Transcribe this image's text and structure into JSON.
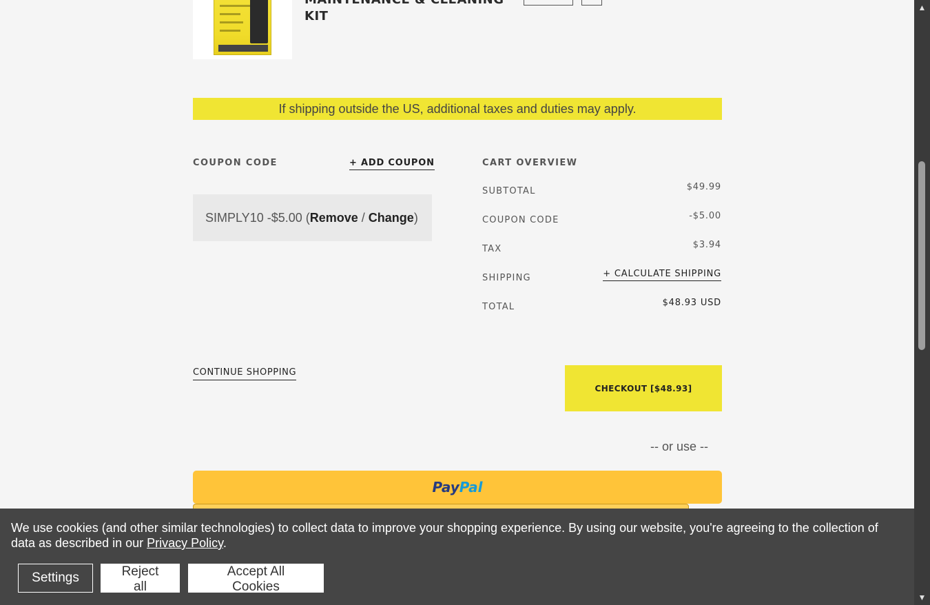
{
  "product": {
    "title": "MAINTENANCE & CLEANING KIT",
    "image_alt": "product-image"
  },
  "notice": "If shipping outside the US, additional taxes and duties may apply.",
  "coupon": {
    "label": "COUPON CODE",
    "add_label": "+ ADD COUPON",
    "applied_code": "SIMPLY10 -$5.00 (",
    "remove": "Remove",
    "sep": " / ",
    "change": "Change",
    "close": ")"
  },
  "overview": {
    "label": "CART OVERVIEW",
    "subtotal_label": "SUBTOTAL",
    "subtotal_value": "$49.99",
    "coupon_label": "COUPON CODE",
    "coupon_value": "-$5.00",
    "tax_label": "TAX",
    "tax_value": "$3.94",
    "shipping_label": "SHIPPING",
    "shipping_action": "+ CALCULATE SHIPPING",
    "total_label": "TOTAL",
    "total_value": "$48.93 USD"
  },
  "actions": {
    "continue_shopping": "CONTINUE SHOPPING",
    "checkout": "CHECKOUT [$48.93]",
    "or_use": "-- or use --",
    "paypal_part1": "Pay",
    "paypal_part2": "Pal"
  },
  "cookie": {
    "text_before": "We use cookies (and other similar technologies) to collect data to improve your shopping experience. By using our website, you're agreeing to the collection of data as described in our ",
    "privacy_link": "Privacy Policy",
    "text_after": ".",
    "settings": "Settings",
    "reject": "Reject all",
    "accept": "Accept All Cookies"
  },
  "scrollbar": {
    "up": "▲",
    "down": "▼"
  },
  "colors": {
    "accent_yellow": "#f0e533",
    "paypal_yellow": "#ffc439",
    "cookie_bg": "#454545",
    "page_bg": "#f5f5f5"
  }
}
